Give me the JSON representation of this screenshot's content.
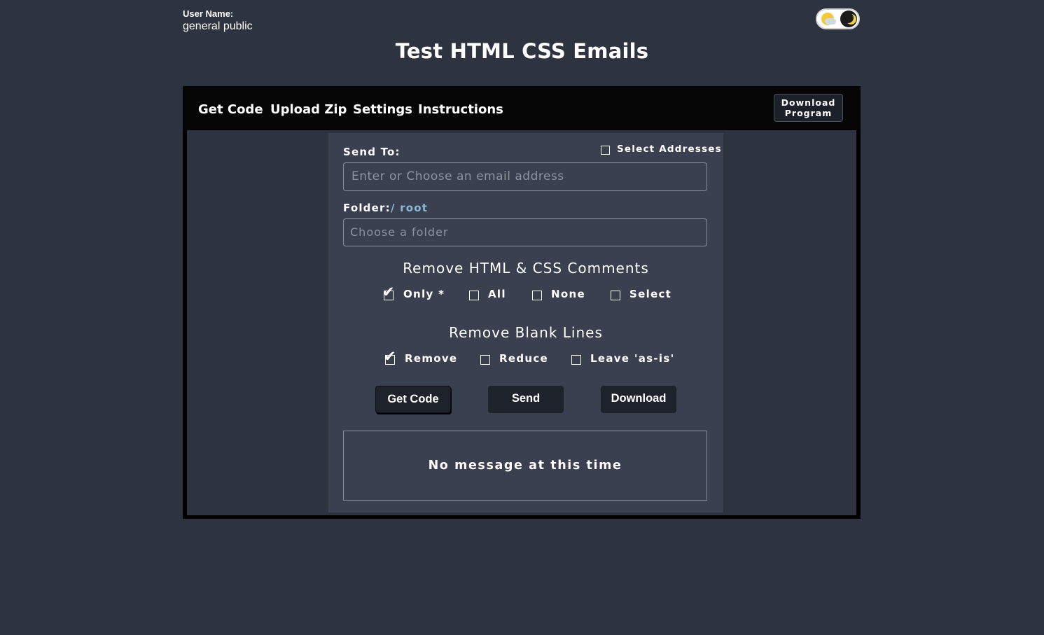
{
  "user": {
    "label": "User Name:",
    "value": "general public"
  },
  "theme_toggle": {
    "icons": [
      "sun-cloud-icon",
      "moon-icon"
    ],
    "state": "dark"
  },
  "page": {
    "title": "Test HTML CSS Emails"
  },
  "nav": {
    "items": [
      "Get Code",
      "Upload Zip",
      "Settings",
      "Instructions"
    ],
    "download_program": "Download Program"
  },
  "form": {
    "send_to_label": "Send To:",
    "select_addresses_label": "Select Addresses",
    "select_addresses_checked": false,
    "email_placeholder": "Enter or Choose an email address",
    "folder_label": "Folder:",
    "folder_path": "/ root",
    "folder_placeholder": "Choose a folder"
  },
  "comments": {
    "title": "Remove HTML & CSS Comments",
    "options": [
      {
        "label": "Only *",
        "checked": true
      },
      {
        "label": "All",
        "checked": false
      },
      {
        "label": "None",
        "checked": false
      },
      {
        "label": "Select",
        "checked": false
      }
    ]
  },
  "blank_lines": {
    "title": "Remove Blank Lines",
    "options": [
      {
        "label": "Remove",
        "checked": true
      },
      {
        "label": "Reduce",
        "checked": false
      },
      {
        "label": "Leave 'as-is'",
        "checked": false
      }
    ]
  },
  "buttons": {
    "get_code": "Get Code",
    "send": "Send",
    "download": "Download"
  },
  "message": {
    "text": "No message at this time"
  },
  "colors": {
    "page_bg": "#2e3340",
    "panel_bg": "#3b4050",
    "frame_bg": "#000000",
    "button_bg": "#1e222b",
    "folder_path": "#8ab8d8"
  }
}
